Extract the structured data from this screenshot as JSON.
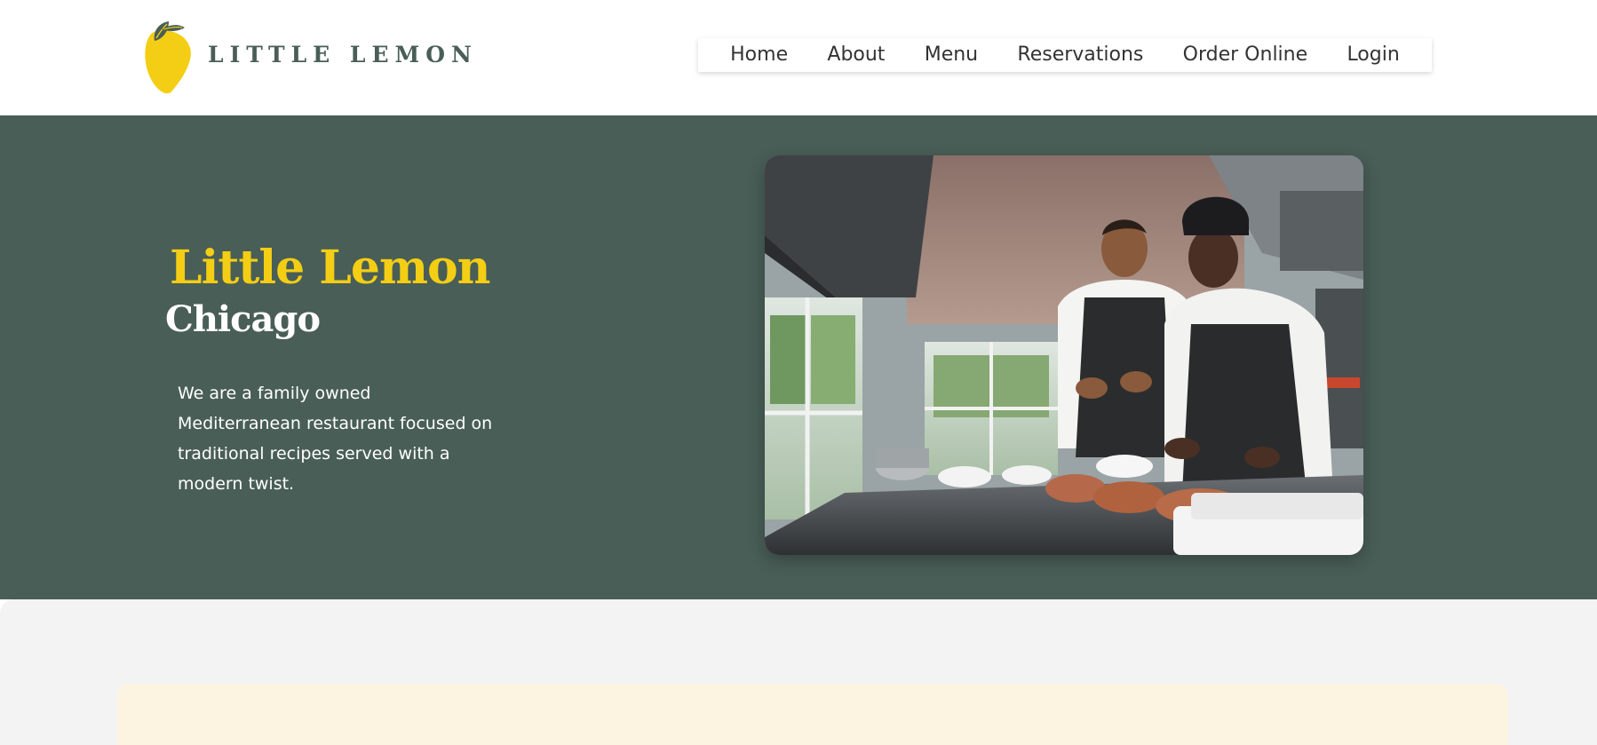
{
  "brand": {
    "name": "LITTLE LEMON",
    "logo_icon": "lemon-icon",
    "colors": {
      "primary_green": "#495e57",
      "primary_yellow": "#f4ce14",
      "cream": "#fcf4e1",
      "light_gray": "#f3f3f3"
    }
  },
  "nav": {
    "items": [
      {
        "label": "Home"
      },
      {
        "label": "About"
      },
      {
        "label": "Menu"
      },
      {
        "label": "Reservations"
      },
      {
        "label": "Order Online"
      },
      {
        "label": "Login"
      }
    ]
  },
  "hero": {
    "title": "Little Lemon",
    "subtitle": "Chicago",
    "description": "We are a family owned Mediterranean restaurant focused on traditional recipes served with a modern twist.",
    "image_alt": "chefs-in-kitchen-photo"
  }
}
